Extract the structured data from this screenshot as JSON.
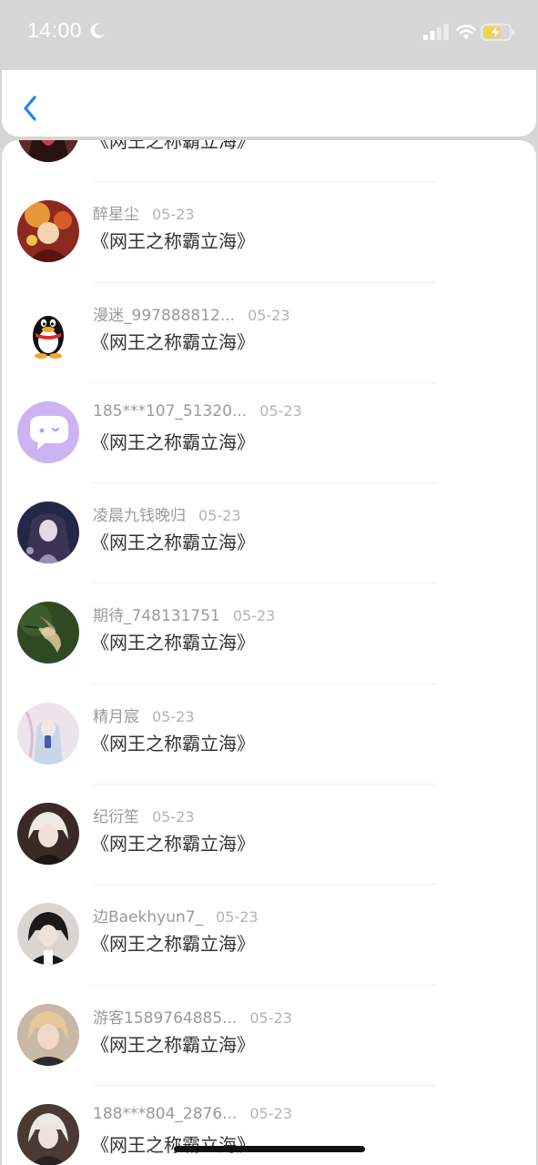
{
  "status_bar": {
    "time": "14:00",
    "icons": [
      "moon-icon",
      "signal-icon",
      "wifi-icon",
      "battery-charging-icon"
    ]
  },
  "header": {
    "back_icon": "chevron-left-icon"
  },
  "accent_color": "#1e88e5",
  "items": [
    {
      "name": "",
      "date": "",
      "message": "《网王之称霸立海》",
      "avatar": "anime-avatar"
    },
    {
      "name": "醉星尘",
      "date": "05-23",
      "message": "《网王之称霸立海》",
      "avatar": "anime-avatar"
    },
    {
      "name": "漫迷_997888812...",
      "date": "05-23",
      "message": "《网王之称霸立海》",
      "avatar": "qq-penguin-avatar"
    },
    {
      "name": "185***107_51320...",
      "date": "05-23",
      "message": "《网王之称霸立海》",
      "avatar": "purple-chat-avatar"
    },
    {
      "name": "凌晨九钱晚归",
      "date": "05-23",
      "message": "《网王之称霸立海》",
      "avatar": "anime-avatar"
    },
    {
      "name": "期待_748131751",
      "date": "05-23",
      "message": "《网王之称霸立海》",
      "avatar": "hummingbird-avatar"
    },
    {
      "name": "精月宸",
      "date": "05-23",
      "message": "《网王之称霸立海》",
      "avatar": "anime-avatar"
    },
    {
      "name": "纪衍笙",
      "date": "05-23",
      "message": "《网王之称霸立海》",
      "avatar": "anime-avatar"
    },
    {
      "name": "边Baekhyun7_",
      "date": "05-23",
      "message": "《网王之称霸立海》",
      "avatar": "anime-avatar"
    },
    {
      "name": "游客1589764885...",
      "date": "05-23",
      "message": "《网王之称霸立海》",
      "avatar": "photo-avatar"
    },
    {
      "name": "188***804_2876...",
      "date": "05-23",
      "message": "《网王之称霸立海》",
      "avatar": "anime-avatar"
    }
  ]
}
